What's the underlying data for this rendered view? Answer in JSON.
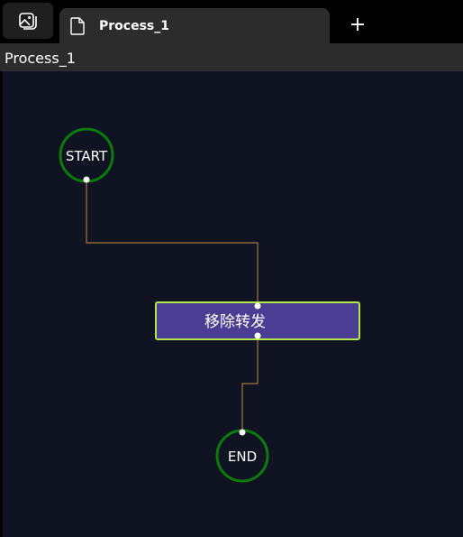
{
  "tabs": [
    {
      "label": "Process_1",
      "icon": "document-icon",
      "active": true
    }
  ],
  "toolbar": {
    "gallery_icon": "gallery-icon",
    "new_tab_label": "+"
  },
  "document": {
    "title": "Process_1"
  },
  "flow": {
    "nodes": {
      "start": {
        "label": "START",
        "shape": "circle",
        "border_color": "#0e7a0d"
      },
      "action": {
        "label": "移除转发",
        "shape": "rectangle",
        "fill_color": "#4b3d94",
        "border_color": "#b4e84a"
      },
      "end": {
        "label": "END",
        "shape": "circle",
        "border_color": "#0e7a0d"
      }
    },
    "connector_color": "#a07a3c",
    "connections": [
      {
        "from": "start",
        "to": "action"
      },
      {
        "from": "action",
        "to": "end"
      }
    ]
  },
  "colors": {
    "canvas_background": "#0f1322",
    "tab_background": "#2c2c2c",
    "window_background": "#000000"
  }
}
